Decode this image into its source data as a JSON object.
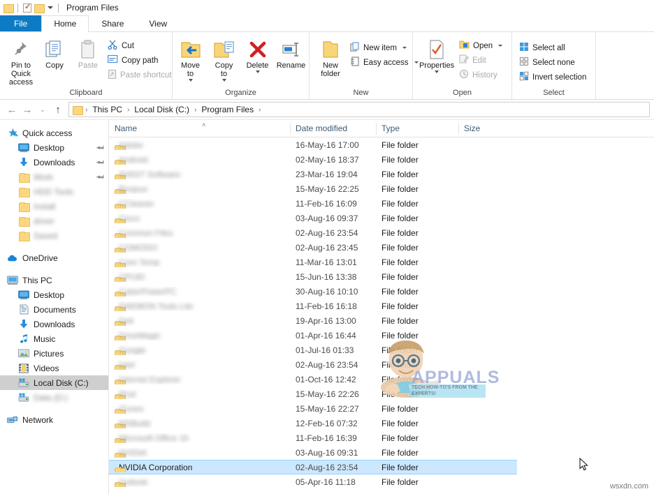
{
  "window": {
    "title": "Program Files",
    "quick_access_toolbar": [
      "folder-icon",
      "properties-icon",
      "folder-icon",
      "customize-caret"
    ]
  },
  "tabs": [
    {
      "label": "File",
      "name": "tab-file",
      "state": "file"
    },
    {
      "label": "Home",
      "name": "tab-home",
      "state": "active"
    },
    {
      "label": "Share",
      "name": "tab-share",
      "state": "normal"
    },
    {
      "label": "View",
      "name": "tab-view",
      "state": "normal"
    }
  ],
  "ribbon": {
    "groups": [
      {
        "label": "Clipboard",
        "big_buttons": [
          {
            "label": "Pin to Quick\naccess",
            "icon": "pin-icon",
            "disabled": false
          },
          {
            "label": "Copy",
            "icon": "copy-icon",
            "disabled": false
          },
          {
            "label": "Paste",
            "icon": "paste-icon",
            "disabled": true
          }
        ],
        "small_buttons": [
          {
            "label": "Cut",
            "icon": "scissors-icon",
            "disabled": false
          },
          {
            "label": "Copy path",
            "icon": "copy-path-icon",
            "disabled": false
          },
          {
            "label": "Paste shortcut",
            "icon": "paste-shortcut-icon",
            "disabled": true
          }
        ]
      },
      {
        "label": "Organize",
        "big_buttons": [
          {
            "label": "Move\nto",
            "icon": "move-to-icon",
            "caret": true
          },
          {
            "label": "Copy\nto",
            "icon": "copy-to-icon",
            "caret": true
          },
          {
            "label": "Delete",
            "icon": "delete-icon",
            "caret": true
          },
          {
            "label": "Rename",
            "icon": "rename-icon",
            "caret": false
          }
        ]
      },
      {
        "label": "New",
        "big_buttons": [
          {
            "label": "New\nfolder",
            "icon": "new-folder-icon"
          }
        ],
        "small_buttons": [
          {
            "label": "New item",
            "icon": "new-item-icon",
            "caret": true
          },
          {
            "label": "Easy access",
            "icon": "easy-access-icon",
            "caret": true
          }
        ]
      },
      {
        "label": "Open",
        "big_buttons": [
          {
            "label": "Properties",
            "icon": "properties-icon",
            "caret": true
          }
        ],
        "small_buttons": [
          {
            "label": "Open",
            "icon": "open-icon",
            "caret": true,
            "disabled": false
          },
          {
            "label": "Edit",
            "icon": "edit-icon",
            "disabled": true
          },
          {
            "label": "History",
            "icon": "history-icon",
            "disabled": true
          }
        ]
      },
      {
        "label": "Select",
        "small_buttons": [
          {
            "label": "Select all",
            "icon": "select-all-icon"
          },
          {
            "label": "Select none",
            "icon": "select-none-icon"
          },
          {
            "label": "Invert selection",
            "icon": "invert-selection-icon"
          }
        ]
      }
    ]
  },
  "address_bar": {
    "back": "←",
    "forward": "→",
    "recent": "⌄",
    "up": "↑",
    "breadcrumbs": [
      "This PC",
      "Local Disk (C:)",
      "Program Files"
    ],
    "separator": "›"
  },
  "sidebar": {
    "items": [
      {
        "label": "Quick access",
        "icon": "star-icon",
        "indent": 0,
        "selected": false,
        "pinned": false,
        "blurred": false
      },
      {
        "label": "Desktop",
        "icon": "desktop-icon",
        "indent": 1,
        "selected": false,
        "pinned": true,
        "blurred": false
      },
      {
        "label": "Downloads",
        "icon": "download-icon",
        "indent": 1,
        "selected": false,
        "pinned": true,
        "blurred": false
      },
      {
        "label": "Work",
        "icon": "folder-icon",
        "indent": 1,
        "selected": false,
        "pinned": true,
        "blurred": true
      },
      {
        "label": "HDD Tools",
        "icon": "folder-icon",
        "indent": 1,
        "selected": false,
        "pinned": false,
        "blurred": true
      },
      {
        "label": "Install",
        "icon": "folder-icon",
        "indent": 1,
        "selected": false,
        "pinned": false,
        "blurred": true
      },
      {
        "label": "driver",
        "icon": "folder-icon",
        "indent": 1,
        "selected": false,
        "pinned": false,
        "blurred": true
      },
      {
        "label": "Saved",
        "icon": "folder-icon",
        "indent": 1,
        "selected": false,
        "pinned": false,
        "blurred": true
      },
      {
        "label": "OneDrive",
        "icon": "cloud-icon",
        "indent": 0,
        "selected": false,
        "pinned": false,
        "blurred": false,
        "gap_before": true
      },
      {
        "label": "This PC",
        "icon": "pc-icon",
        "indent": 0,
        "selected": false,
        "pinned": false,
        "blurred": false,
        "gap_before": true
      },
      {
        "label": "Desktop",
        "icon": "desktop-icon",
        "indent": 1,
        "selected": false,
        "pinned": false,
        "blurred": false
      },
      {
        "label": "Documents",
        "icon": "documents-icon",
        "indent": 1,
        "selected": false,
        "pinned": false,
        "blurred": false
      },
      {
        "label": "Downloads",
        "icon": "download-icon",
        "indent": 1,
        "selected": false,
        "pinned": false,
        "blurred": false
      },
      {
        "label": "Music",
        "icon": "music-icon",
        "indent": 1,
        "selected": false,
        "pinned": false,
        "blurred": false
      },
      {
        "label": "Pictures",
        "icon": "pictures-icon",
        "indent": 1,
        "selected": false,
        "pinned": false,
        "blurred": false
      },
      {
        "label": "Videos",
        "icon": "videos-icon",
        "indent": 1,
        "selected": false,
        "pinned": false,
        "blurred": false
      },
      {
        "label": "Local Disk (C:)",
        "icon": "drive-icon",
        "indent": 1,
        "selected": true,
        "pinned": false,
        "blurred": false
      },
      {
        "label": "Data (D:)",
        "icon": "drive-icon",
        "indent": 1,
        "selected": false,
        "pinned": false,
        "blurred": true
      },
      {
        "label": "Network",
        "icon": "network-icon",
        "indent": 0,
        "selected": false,
        "pinned": false,
        "blurred": false,
        "gap_before": true
      }
    ]
  },
  "file_list": {
    "columns": [
      {
        "label": "Name",
        "sorted": "asc"
      },
      {
        "label": "Date modified",
        "sorted": ""
      },
      {
        "label": "Type",
        "sorted": ""
      },
      {
        "label": "Size",
        "sorted": ""
      }
    ],
    "sort_glyph": "˄",
    "rows": [
      {
        "name": "Adobe",
        "date": "16-May-16 17:00",
        "type": "File folder",
        "size": "",
        "selected": false,
        "blurred": true
      },
      {
        "name": "Android",
        "date": "02-May-16 18:37",
        "type": "File folder",
        "size": "",
        "selected": false,
        "blurred": true
      },
      {
        "name": "AVAST Software",
        "date": "23-Mar-16 19:04",
        "type": "File folder",
        "size": "",
        "selected": false,
        "blurred": true
      },
      {
        "name": "Bonjour",
        "date": "15-May-16 22:25",
        "type": "File folder",
        "size": "",
        "selected": false,
        "blurred": true
      },
      {
        "name": "CCleaner",
        "date": "11-Feb-16 16:09",
        "type": "File folder",
        "size": "",
        "selected": false,
        "blurred": true
      },
      {
        "name": "Cisco",
        "date": "03-Aug-16 09:37",
        "type": "File folder",
        "size": "",
        "selected": false,
        "blurred": true
      },
      {
        "name": "Common Files",
        "date": "02-Aug-16 23:54",
        "type": "File folder",
        "size": "",
        "selected": false,
        "blurred": true
      },
      {
        "name": "COMODO",
        "date": "02-Aug-16 23:45",
        "type": "File folder",
        "size": "",
        "selected": false,
        "blurred": true
      },
      {
        "name": "Core Temp",
        "date": "11-Mar-16 13:01",
        "type": "File folder",
        "size": "",
        "selected": false,
        "blurred": true
      },
      {
        "name": "CPUID",
        "date": "15-Jun-16 13:38",
        "type": "File folder",
        "size": "",
        "selected": false,
        "blurred": true
      },
      {
        "name": "CyberPowerPC",
        "date": "30-Aug-16 10:10",
        "type": "File folder",
        "size": "",
        "selected": false,
        "blurred": true
      },
      {
        "name": "DAEMON Tools Lite",
        "date": "11-Feb-16 16:18",
        "type": "File folder",
        "size": "",
        "selected": false,
        "blurred": true
      },
      {
        "name": "Dell",
        "date": "19-Apr-16 13:00",
        "type": "File folder",
        "size": "",
        "selected": false,
        "blurred": true
      },
      {
        "name": "DriveMagic",
        "date": "01-Apr-16 16:44",
        "type": "File folder",
        "size": "",
        "selected": false,
        "blurred": true
      },
      {
        "name": "Google",
        "date": "01-Jul-16 01:33",
        "type": "File folder",
        "size": "",
        "selected": false,
        "blurred": true
      },
      {
        "name": "Intel",
        "date": "02-Aug-16 23:54",
        "type": "File folder",
        "size": "",
        "selected": false,
        "blurred": true
      },
      {
        "name": "Internet Explorer",
        "date": "01-Oct-16 12:42",
        "type": "File folder",
        "size": "",
        "selected": false,
        "blurred": true
      },
      {
        "name": "iPod",
        "date": "15-May-16 22:26",
        "type": "File folder",
        "size": "",
        "selected": false,
        "blurred": true
      },
      {
        "name": "iTunes",
        "date": "15-May-16 22:27",
        "type": "File folder",
        "size": "",
        "selected": false,
        "blurred": true
      },
      {
        "name": "MSBuild",
        "date": "12-Feb-16 07:32",
        "type": "File folder",
        "size": "",
        "selected": false,
        "blurred": true
      },
      {
        "name": "Microsoft Office 15",
        "date": "11-Feb-16 16:39",
        "type": "File folder",
        "size": "",
        "selected": false,
        "blurred": true
      },
      {
        "name": "NVIDIA",
        "date": "03-Aug-16 09:31",
        "type": "File folder",
        "size": "",
        "selected": false,
        "blurred": true
      },
      {
        "name": "NVIDIA Corporation",
        "date": "02-Aug-16 23:54",
        "type": "File folder",
        "size": "",
        "selected": true,
        "blurred": false
      },
      {
        "name": "Outlook",
        "date": "05-Apr-16 11:18",
        "type": "File folder",
        "size": "",
        "selected": false,
        "blurred": true
      }
    ]
  },
  "watermarks": {
    "appuals_brand": "APPUALS",
    "appuals_tagline": "TECH HOW-TO'S FROM THE EXPERTS!",
    "corner": "wsxdn.com"
  },
  "colors": {
    "file_tab_blue": "#0d7bc4",
    "selection_blue": "#cce8ff",
    "folder_yellow": "#fcd77f",
    "nav_selected_grey": "#cfcfcf"
  }
}
